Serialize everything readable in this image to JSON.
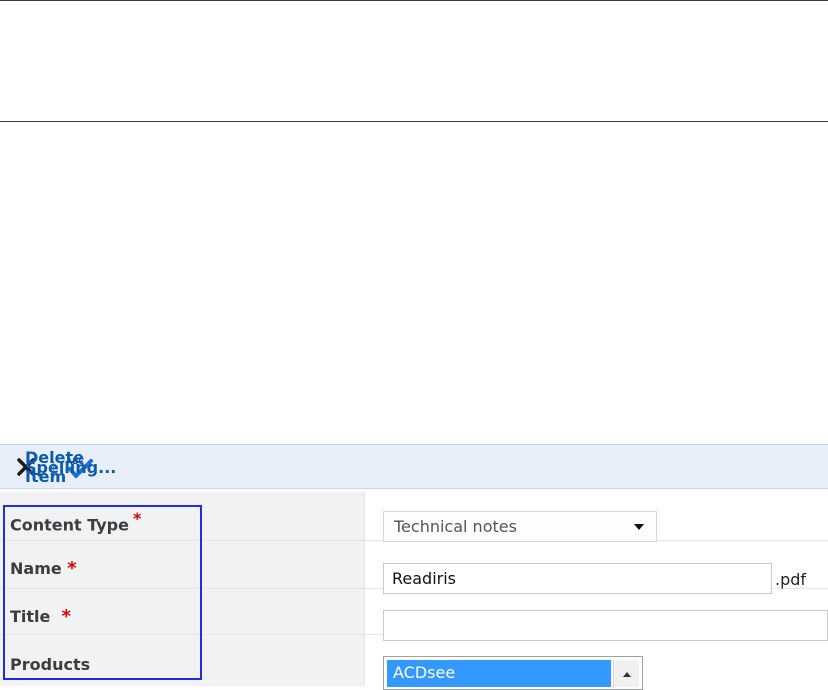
{
  "toolbar": {
    "delete_label": "Delete Item",
    "separator": "|",
    "spelling_label": "Spelling..."
  },
  "form": {
    "content_type_label": "Content Type",
    "content_type_value": "Technical notes",
    "name_label": "Name",
    "name_value": "Readiris",
    "name_extension": ".pdf",
    "title_label": "Title",
    "title_value": "",
    "products_label": "Products",
    "products_selected": "ACDsee",
    "required_marker": "*"
  },
  "colors": {
    "toolbar_bg": "#e9eff8",
    "link": "#0b5bb0",
    "required": "#e00000",
    "selection": "#3399ff",
    "highlight_box": "#1f2ee0"
  }
}
